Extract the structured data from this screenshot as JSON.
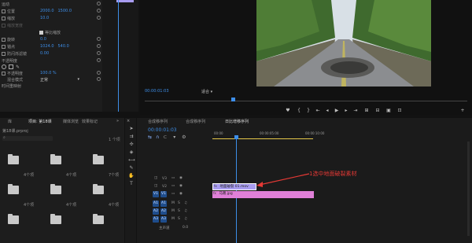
{
  "effects": {
    "motion": "运动",
    "position_label": "位置",
    "position_x": "2000.0",
    "position_y": "1500.0",
    "scale_label": "缩放",
    "scale_value": "10.0",
    "scale_width_label": "缩放宽度",
    "uniform_scale_label": "等比缩放",
    "rotation_label": "旋转",
    "rotation_value": "0.0",
    "anchor_label": "锚点",
    "anchor_x": "1024.0",
    "anchor_y": "540.0",
    "antiflicker_label": "防闪烁滤镜",
    "antiflicker_value": "0.00",
    "opacity_section": "不透明度",
    "opacity_label": "不透明度",
    "opacity_value": "100.0 %",
    "blend_label": "混合模式",
    "blend_value": "正常",
    "time_remap": "时间重映射"
  },
  "preview": {
    "timecode": "00:00:01:03",
    "fit": "适合"
  },
  "project": {
    "tabs": [
      "库",
      "项目: 第18课",
      "媒体浏览",
      "效果",
      "标记"
    ],
    "project_file": "第18课.prproj",
    "items": [
      {
        "label": "",
        "count": "4个项"
      },
      {
        "label": "",
        "count": "4个项"
      },
      {
        "label": "",
        "count": "7个项"
      },
      {
        "label": "",
        "count": "4个项"
      },
      {
        "label": "",
        "count": "4个项"
      },
      {
        "label": "",
        "count": "4个项"
      },
      {
        "label": "",
        "count": ""
      },
      {
        "label": "",
        "count": ""
      }
    ],
    "item_names": [
      "",
      "",
      "",
      "",
      "",
      ""
    ]
  },
  "timeline": {
    "tabs": [
      "合成移序列",
      "合成移序列",
      "日比增移序列"
    ],
    "timecode": "00:00:01:03",
    "ruler": [
      "00:00",
      "00:00:05:00",
      "00:00:10:00"
    ],
    "tracks": {
      "v3": "V3",
      "v2": "V2",
      "v1": "V1",
      "a1": "A1",
      "a2": "A2",
      "a3": "A3",
      "master": "主声道",
      "master_value": "0.0"
    },
    "clip_v2": "地面破裂 01.mov",
    "clip_v1": "马路.jpg"
  },
  "annotation": {
    "text": "1选中地面破裂素材",
    "color": "#e53935"
  },
  "colors": {
    "accent": "#3d8ee8",
    "clip_pink": "#e080d8",
    "clip_purple": "#a89cf0",
    "timeline_yellow": "#e6c84a"
  }
}
